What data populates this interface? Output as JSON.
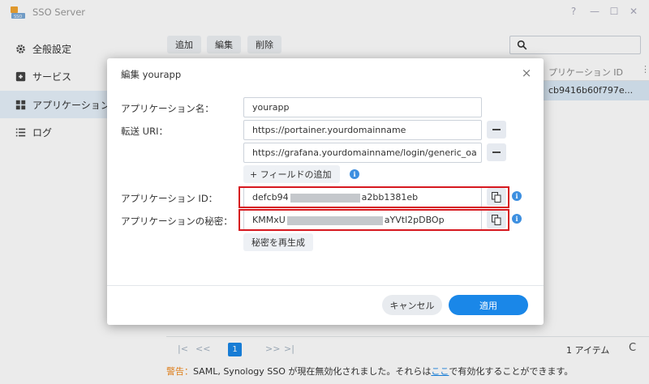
{
  "window": {
    "title": "SSO Server",
    "controls": {
      "help": "?",
      "minimize": "—",
      "maximize": "☐",
      "close": "✕"
    }
  },
  "sidebar": {
    "items": [
      {
        "label": "全般設定",
        "icon": "gear-icon"
      },
      {
        "label": "サービス",
        "icon": "service-icon"
      },
      {
        "label": "アプリケーション",
        "icon": "apps-grid-icon",
        "active": true
      },
      {
        "label": "ログ",
        "icon": "log-list-icon"
      }
    ]
  },
  "toolbar": {
    "add": "追加",
    "edit": "編集",
    "delete": "削除"
  },
  "grid": {
    "column_title": "プリケーション ID",
    "column_menu": "⋮",
    "row_id": "cb9416b60f797e..."
  },
  "pager": {
    "first": "|<",
    "prev": "<<",
    "current": "1",
    "next": ">>",
    "last": ">|",
    "count": "1 アイテム",
    "refresh": "C"
  },
  "warning": {
    "label": "警告：",
    "text_before": "SAML, Synology SSO が現在無効化されました。それらは",
    "link": "ここ",
    "text_after": "で有効化することができます。"
  },
  "dialog": {
    "title": "編集 yourapp",
    "close": "×",
    "fields": {
      "app_name_label": "アプリケーション名：",
      "app_name_value": "yourapp",
      "redirect_uri_label": "転送 URI：",
      "redirect_uri_1": "https://portainer.yourdomainname",
      "redirect_uri_2": "https://grafana.yourdomainname/login/generic_oa",
      "add_field": "+ フィールドの追加",
      "app_id_label": "アプリケーション ID：",
      "app_id_prefix": "defcb94",
      "app_id_suffix": "a2bb1381eb",
      "secret_label": "アプリケーションの秘密：",
      "secret_prefix": "KMMxU",
      "secret_suffix": "aYVtl2pDBOp",
      "regenerate": "秘密を再生成"
    },
    "cancel": "キャンセル",
    "apply": "適用"
  },
  "colors": {
    "accent": "#1a87e8",
    "highlight": "#d6181f",
    "warning": "#f0891e"
  }
}
